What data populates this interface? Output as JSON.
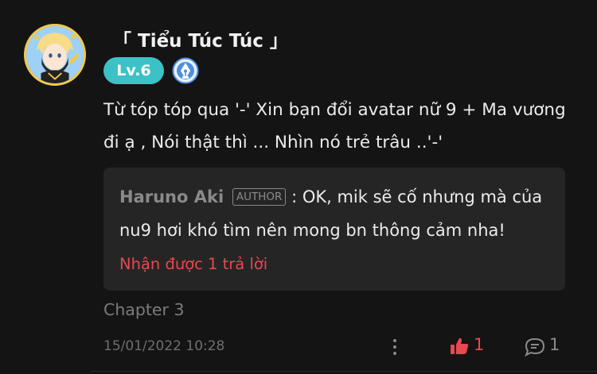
{
  "comment": {
    "username": "「 Tiểu Túc Túc 」",
    "level": "Lv.6",
    "text": "Từ tóp tóp qua '-' Xin bạn đổi avatar nữ 9 + Ma vương đi ạ , Nói thật thì ... Nhìn nó trẻ trâu ..'-'",
    "chapter": "Chapter 3",
    "timestamp": "15/01/2022 10:28",
    "like_count": "1",
    "reply_count": "1"
  },
  "reply": {
    "author": "Haruno Aki",
    "author_tag": "AUTHOR",
    "text": ": OK, mik sẽ cố nhưng mà của nu9 hơi khó tìm nên mong bn thông cảm nha!",
    "more_replies_label": "Nhận được 1 trả lời"
  },
  "icons": {
    "avatar": "anime-avatar",
    "role": "pen-nib-badge-icon",
    "more": "more-vertical-icon",
    "like": "thumbs-up-icon",
    "comment": "comment-bubble-icon"
  },
  "colors": {
    "background": "#141414",
    "level_badge": "#3cc2c6",
    "accent_red": "#e8484f",
    "reply_box": "#252525",
    "muted": "#7c7c7c"
  }
}
